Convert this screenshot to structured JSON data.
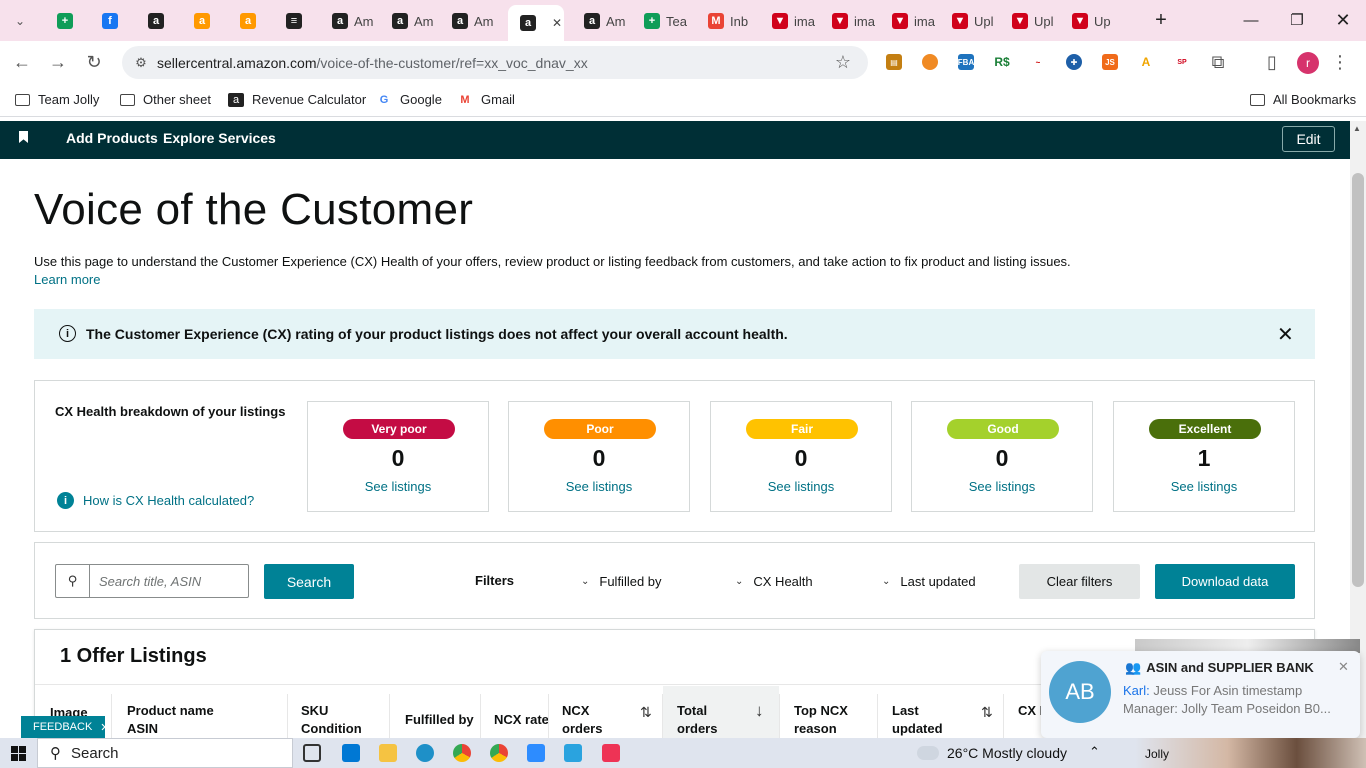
{
  "browser": {
    "tabs": [
      {
        "label": "",
        "icon": "sheets-icon",
        "color": "#0f9d58",
        "glyph": "+"
      },
      {
        "label": "",
        "icon": "facebook-icon",
        "color": "#1877f2",
        "glyph": "f"
      },
      {
        "label": "",
        "icon": "amazon-icon",
        "color": "#222222",
        "glyph": "a"
      },
      {
        "label": "",
        "icon": "amazon-smile-icon",
        "color": "#ff9900",
        "glyph": "a"
      },
      {
        "label": "",
        "icon": "amazon-smile-icon",
        "color": "#ff9900",
        "glyph": "a"
      },
      {
        "label": "",
        "icon": "app-icon",
        "color": "#222222",
        "glyph": "≡"
      },
      {
        "label": "Am",
        "icon": "amazon-icon",
        "color": "#222222",
        "glyph": "a"
      },
      {
        "label": "Am",
        "icon": "amazon-icon",
        "color": "#222222",
        "glyph": "a"
      },
      {
        "label": "Am",
        "icon": "amazon-icon",
        "color": "#222222",
        "glyph": "a"
      },
      {
        "label": "",
        "icon": "amazon-icon",
        "color": "#222222",
        "glyph": "a",
        "active": true
      },
      {
        "label": "Am",
        "icon": "amazon-icon",
        "color": "#222222",
        "glyph": "a"
      },
      {
        "label": "Tea",
        "icon": "sheets-icon",
        "color": "#0f9d58",
        "glyph": "+"
      },
      {
        "label": "Inb",
        "icon": "gmail-icon",
        "color": "#ea4335",
        "glyph": "M"
      },
      {
        "label": "ima",
        "icon": "helium-icon",
        "color": "#d0021b",
        "glyph": "▼"
      },
      {
        "label": "ima",
        "icon": "helium-icon",
        "color": "#d0021b",
        "glyph": "▼"
      },
      {
        "label": "ima",
        "icon": "helium-icon",
        "color": "#d0021b",
        "glyph": "▼"
      },
      {
        "label": "Upl",
        "icon": "helium-icon",
        "color": "#d0021b",
        "glyph": "▼"
      },
      {
        "label": "Upl",
        "icon": "helium-icon",
        "color": "#d0021b",
        "glyph": "▼"
      },
      {
        "label": "Up",
        "icon": "helium-icon",
        "color": "#d0021b",
        "glyph": "▼"
      }
    ],
    "url_host": "sellercentral.amazon.com",
    "url_path": "/voice-of-the-customer/ref=xx_voc_dnav_xx",
    "profile_initial": "r",
    "bookmarks": [
      {
        "label": "Team Jolly",
        "icon": "folder-icon"
      },
      {
        "label": "Other sheet",
        "icon": "folder-icon"
      },
      {
        "label": "Revenue Calculator",
        "icon": "amazon-icon"
      },
      {
        "label": "Google",
        "icon": "google-icon"
      },
      {
        "label": "Gmail",
        "icon": "gmail-icon"
      }
    ],
    "all_bookmarks": "All Bookmarks"
  },
  "topnav": {
    "add_products": "Add Products",
    "explore_services": "Explore Services",
    "edit": "Edit"
  },
  "page": {
    "title": "Voice of the Customer",
    "description": "Use this page to understand the Customer Experience (CX) Health of your offers, review product or listing feedback from customers, and take action to fix product and listing issues.",
    "learn_more": "Learn more",
    "alert": "The Customer Experience (CX) rating of your product listings does not affect your overall account health."
  },
  "cx_health": {
    "heading": "CX Health breakdown of your listings",
    "how_link": "How is CX Health calculated?",
    "categories": [
      {
        "label": "Very poor",
        "count": "0",
        "link": "See listings",
        "color": "#c40c44"
      },
      {
        "label": "Poor",
        "count": "0",
        "link": "See listings",
        "color": "#ff8f00"
      },
      {
        "label": "Fair",
        "count": "0",
        "link": "See listings",
        "color": "#ffc200"
      },
      {
        "label": "Good",
        "count": "0",
        "link": "See listings",
        "color": "#a4d12c"
      },
      {
        "label": "Excellent",
        "count": "1",
        "link": "See listings",
        "color": "#4a6f0b"
      }
    ]
  },
  "filters": {
    "search_placeholder": "Search title, ASIN",
    "search_button": "Search",
    "filters_label": "Filters",
    "fulfilled_by": "Fulfilled by",
    "cx_health": "CX Health",
    "last_updated": "Last updated",
    "clear_filters": "Clear filters",
    "download_data": "Download data"
  },
  "listings": {
    "title": "1 Offer Listings",
    "columns": {
      "image": "Image",
      "product_name": "Product name",
      "asin": "ASIN",
      "sku": "SKU",
      "condition": "Condition",
      "fulfilled_by": "Fulfilled by",
      "ncx_rate": "NCX rate",
      "ncx_orders_1": "NCX",
      "ncx_orders_2": "orders",
      "total_orders_1": "Total",
      "total_orders_2": "orders",
      "top_ncx_1": "Top NCX",
      "top_ncx_2": "reason",
      "last_updated_1": "Last",
      "last_updated_2": "updated",
      "cx_health": "CX H"
    }
  },
  "feedback": "FEEDBACK",
  "notification": {
    "avatar": "AB",
    "title": "ASIN and SUPPLIER BANK",
    "sender": "Karl:",
    "line1": " Jeuss  For Asin timestamp",
    "line2": "Manager: Jolly Team Poseidon B0..."
  },
  "taskbar": {
    "search": "Search",
    "weather": "26°C  Mostly cloudy",
    "webcam_label": "Jolly"
  }
}
